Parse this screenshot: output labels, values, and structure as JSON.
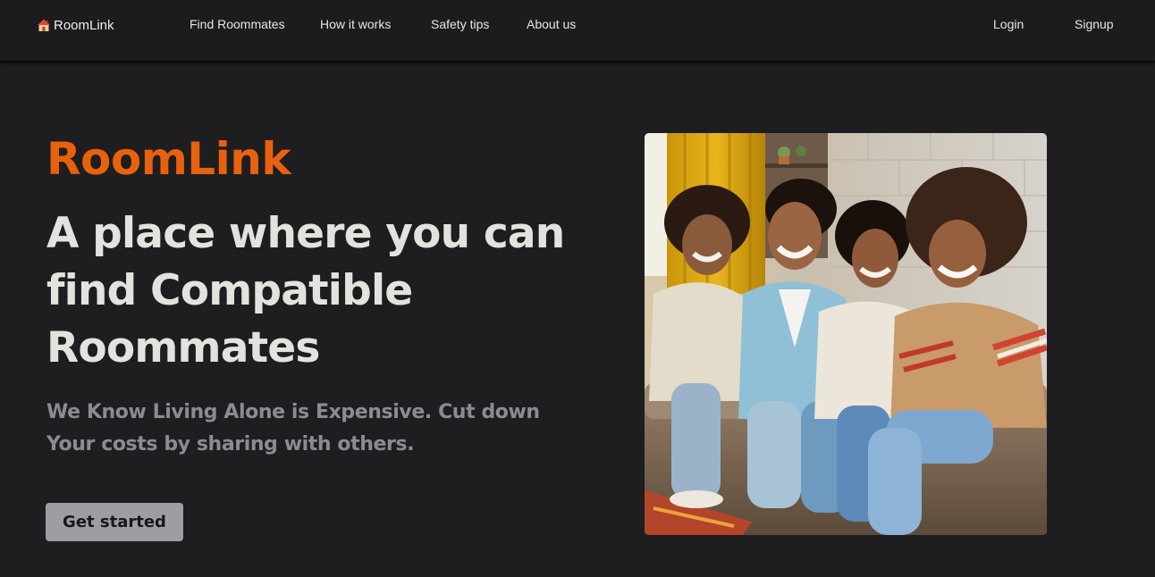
{
  "nav": {
    "brand": "RoomLink",
    "brand_icon": "house-icon",
    "links": [
      "Find Roommates",
      "How it works",
      "Safety tips",
      "About us"
    ],
    "login": "Login",
    "signup": "Signup"
  },
  "hero": {
    "brand": "RoomLink",
    "title": "A place where you can find Compatible Roommates",
    "subtitle": "We Know Living Alone is Expensive. Cut down Your costs by sharing with others.",
    "cta": "Get started",
    "image_subject": "four-friends-laughing-on-couch"
  },
  "colors": {
    "background": "#1e1e20",
    "accent": "#e8610e",
    "button": "#9d9ea3",
    "muted_text": "#8b8b94"
  }
}
